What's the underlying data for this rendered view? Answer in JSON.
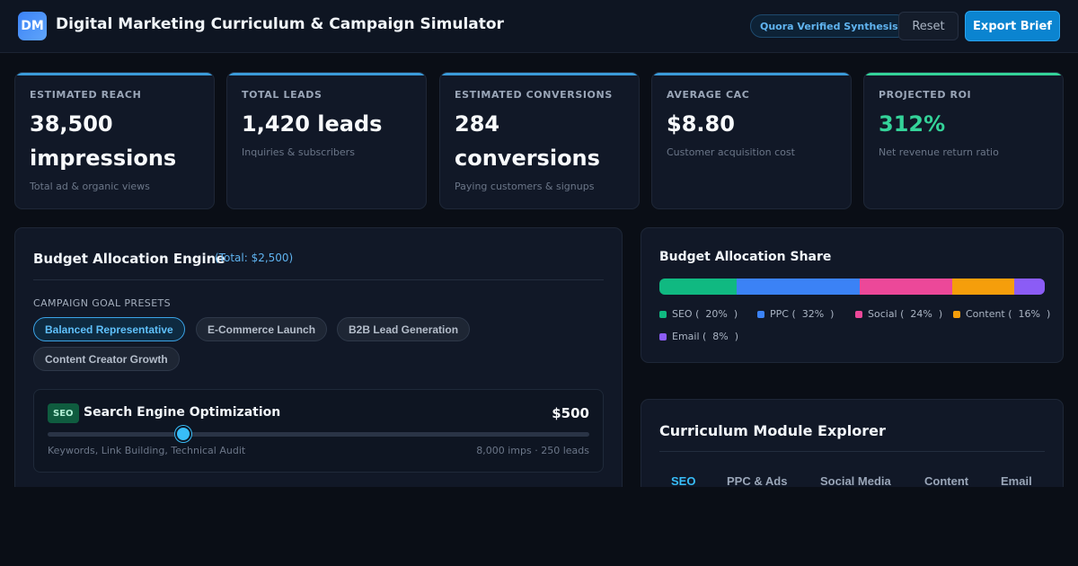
{
  "header": {
    "logo_text": "DM",
    "title": "Digital Marketing Curriculum & Campaign Simulator",
    "badge": "Quora Verified Synthesis",
    "reset_label": "Reset",
    "export_label": "Export Brief"
  },
  "kpis": [
    {
      "label": "ESTIMATED REACH",
      "value": "38,500 impressions",
      "sub": "Total ad & organic views",
      "accent": "#3b9bd9"
    },
    {
      "label": "TOTAL LEADS",
      "value": "1,420 leads",
      "sub": "Inquiries & subscribers",
      "accent": "#3b9bd9"
    },
    {
      "label": "ESTIMATED CONVERSIONS",
      "value": "284 conversions",
      "sub": "Paying customers & signups",
      "accent": "#3b9bd9"
    },
    {
      "label": "AVERAGE CAC",
      "value": "$8.80",
      "sub": "Customer acquisition cost",
      "accent": "#3b9bd9"
    },
    {
      "label": "PROJECTED ROI",
      "value": "312%",
      "sub": "Net revenue return ratio",
      "accent": "#34d399",
      "value_color": "#34d399"
    }
  ],
  "budget": {
    "title": "Budget Allocation Engine",
    "total": "(Total: $2,500)",
    "presets_label": "CAMPAIGN GOAL PRESETS",
    "presets": [
      {
        "label": "Balanced Representative",
        "active": true
      },
      {
        "label": "E-Commerce Launch",
        "active": false
      },
      {
        "label": "B2B Lead Generation",
        "active": false
      },
      {
        "label": "Content Creator Growth",
        "active": false
      }
    ],
    "channels": [
      {
        "tag": "SEO",
        "name": "Search Engine Optimization",
        "amount": "$500",
        "slider_fraction": 0.25,
        "desc": "Keywords, Link Building, Technical Audit",
        "stats": "8,000 imps · 250 leads"
      }
    ]
  },
  "share": {
    "title": "Budget Allocation Share",
    "segments": [
      {
        "name": "SEO",
        "percent": 20,
        "color": "#10b981",
        "label": "SEO (  20%  )"
      },
      {
        "name": "PPC",
        "percent": 32,
        "color": "#3b82f6",
        "label": "PPC (  32%  )"
      },
      {
        "name": "Social",
        "percent": 24,
        "color": "#ec4899",
        "label": "Social (  24%  )"
      },
      {
        "name": "Content",
        "percent": 16,
        "color": "#f59e0b",
        "label": "Content (  16%  )"
      },
      {
        "name": "Email",
        "percent": 8,
        "color": "#8b5cf6",
        "label": "Email (  8%  )"
      }
    ]
  },
  "curriculum": {
    "title": "Curriculum Module Explorer",
    "tabs": [
      {
        "label": "SEO",
        "active": true
      },
      {
        "label": "PPC & Ads",
        "active": false
      },
      {
        "label": "Social Media",
        "active": false
      },
      {
        "label": "Content",
        "active": false
      },
      {
        "label": "Email",
        "active": false
      }
    ]
  }
}
